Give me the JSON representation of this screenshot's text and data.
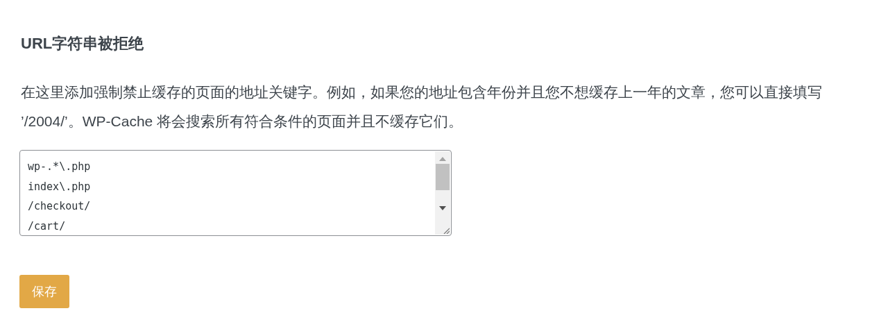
{
  "section": {
    "title": "URL字符串被拒绝",
    "description": "在这里添加强制禁止缓存的页面的地址关键字。例如，如果您的地址包含年份并且您不想缓存上一年的文章，您可以直接填写 ’/2004/’。WP-Cache 将会搜索所有符合条件的页面并且不缓存它们。",
    "field": {
      "value": "wp-.*\\.php\nindex\\.php\n/checkout/\n/cart/"
    },
    "button": {
      "label": "保存"
    }
  }
}
